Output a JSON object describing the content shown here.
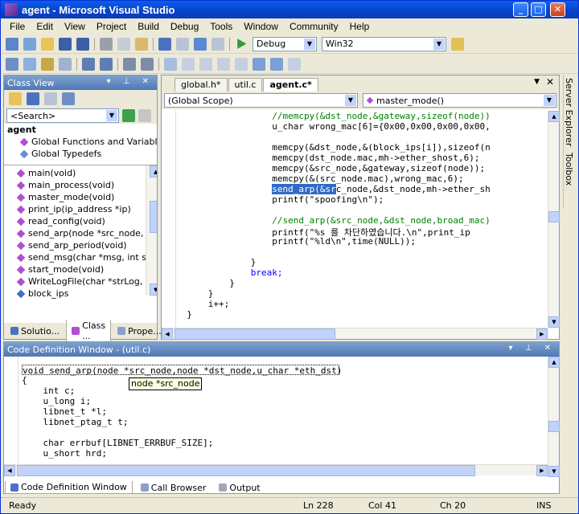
{
  "window": {
    "title": "agent - Microsoft Visual Studio",
    "minimize": "_",
    "maximize": "□",
    "close": "✕"
  },
  "menu": [
    "File",
    "Edit",
    "View",
    "Project",
    "Build",
    "Debug",
    "Tools",
    "Window",
    "Community",
    "Help"
  ],
  "toolbar": {
    "config": "Debug",
    "platform": "Win32"
  },
  "classview": {
    "title": "Class View",
    "search_placeholder": "<Search>",
    "root": "agent",
    "groups": [
      "Global Functions and Variables",
      "Global Typedefs"
    ],
    "members": [
      "main(void)",
      "main_process(void)",
      "master_mode(void)",
      "print_ip(ip_address *ip)",
      "read_config(void)",
      "send_arp(node *src_node, n",
      "send_arp_period(void)",
      "send_msg(char *msg, int siz",
      "start_mode(void)",
      "WriteLogFile(char *strLog, i",
      "block_ips"
    ],
    "tabs": [
      "Solutio...",
      "Class ...",
      "Prope..."
    ]
  },
  "editor": {
    "tabs": [
      "global.h*",
      "util.c",
      "agent.c*"
    ],
    "scope": "(Global Scope)",
    "function": "master_mode()",
    "lines": [
      {
        "t": "                  //memcpy(&dst_node,&gateway,sizeof(node))",
        "c": "cm"
      },
      {
        "t": "                  u_char wrong_mac[6]={0x00,0x00,0x00,0x00,",
        "c": ""
      },
      {
        "t": "",
        "c": ""
      },
      {
        "t": "                  memcpy(&dst_node,&(block_ips[i]),sizeof(n",
        "c": ""
      },
      {
        "t": "                  memcpy(dst_node.mac,mh->ether_shost,6);",
        "c": ""
      },
      {
        "t": "                  memcpy(&src_node,&gateway,sizeof(node));",
        "c": ""
      },
      {
        "t": "                  memcpy(&(src_node.mac),wrong_mac,6);",
        "c": ""
      },
      {
        "t": "                  send_arp(&src_node,&dst_node,mh->ether_sh",
        "c": "hl"
      },
      {
        "t": "                  printf(\"spoofing\\n\");",
        "c": ""
      },
      {
        "t": "",
        "c": ""
      },
      {
        "t": "                  //send_arp(&src_node,&dst_node,broad_mac)",
        "c": "cm"
      },
      {
        "t": "                  printf(\"%s 를 차단하였습니다.\\n\",print_ip",
        "c": ""
      },
      {
        "t": "                  printf(\"%ld\\n\",time(NULL));",
        "c": ""
      },
      {
        "t": "",
        "c": ""
      },
      {
        "t": "              }",
        "c": ""
      },
      {
        "t": "              break;",
        "c": "kw"
      },
      {
        "t": "          }",
        "c": ""
      },
      {
        "t": "      }",
        "c": ""
      },
      {
        "t": "      i++;",
        "c": ""
      },
      {
        "t": "  }",
        "c": ""
      }
    ]
  },
  "sidestrip": [
    "Server Explorer",
    "Toolbox"
  ],
  "codedef": {
    "title": "Code Definition Window - (util.c)",
    "lines": [
      "void send_arp(node *src_node,node *dst_node,u_char *eth_dst)",
      "{",
      "    int c;",
      "    u_long i;",
      "    libnet_t *l;",
      "    libnet_ptag_t t;",
      "",
      "    char errbuf[LIBNET_ERRBUF_SIZE];",
      "    u_short hrd;"
    ],
    "tooltip": "node *src_node",
    "tabs": [
      "Code Definition Window",
      "Call Browser",
      "Output"
    ]
  },
  "status": {
    "ready": "Ready",
    "ln": "Ln 228",
    "col": "Col 41",
    "ch": "Ch 20",
    "ins": "INS"
  }
}
